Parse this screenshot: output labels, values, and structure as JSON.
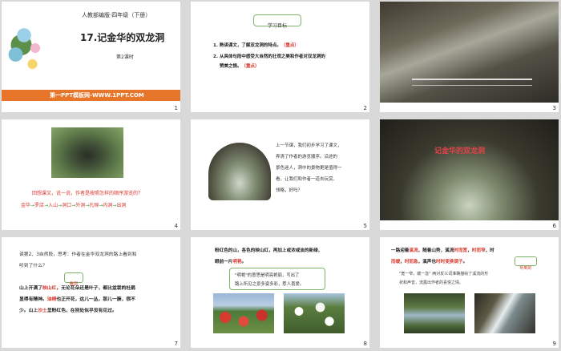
{
  "slides": [
    {
      "num": "1",
      "publisher": "人教部编版·四年级（下册）",
      "title": "17.记金华的双龙洞",
      "subtitle": "第2课时",
      "footer": "第一PPT模板网-WWW.1PPT.COM"
    },
    {
      "num": "2",
      "heading": "学习目标",
      "goal1": "1. 熟读课文，了解双龙洞的特点。",
      "goal1_tag": "（重点）",
      "goal2a": "2. 从具体句段中感受大自然的壮观之美和作者对双龙洞的",
      "goal2b": "赞美之情。",
      "goal2_tag": "（重点）"
    },
    {
      "num": "3"
    },
    {
      "num": "4",
      "question": "回想课文，说一说，作者是按照怎样的顺序游览的？",
      "route": [
        "金华",
        "罗店",
        "入山",
        "洞口",
        "外洞",
        "孔隙",
        "内洞",
        "出洞"
      ],
      "arrow": "→"
    },
    {
      "num": "5",
      "para": [
        "上一节课，我们初步学习了课文，",
        "弄清了作者的游览顺序。沿途的",
        "景色迷人，洞中的景物更是值得一",
        "看，让我们和作者一道去玩赏、",
        "领略，好吗？"
      ]
    },
    {
      "num": "6",
      "overlay_title": "记金华的双龙洞"
    },
    {
      "num": "7",
      "intro": [
        "读第2、3自然段，思考：作者在金华双龙洞的路上看到和",
        "听到了什么？"
      ],
      "tag": "看到",
      "body1_pre": "山上开满了",
      "body1_hl": "映山红",
      "body1_post": "，无论花朵还是叶子，都比盆栽的杜鹃",
      "body2": "显得有精神。",
      "body2_hl": "油桐",
      "body2_post": "也正开花，这儿一丛，那儿一簇，很不",
      "body3_pre": "少。山上",
      "body3_hl": "沙土",
      "body3_post": "呈粉红色，在别处似乎没有见过。"
    },
    {
      "num": "8",
      "line1": "粉红色的山，各色的映山红，再加上或浓或淡的新绿，",
      "line2_pre": "眼前一片",
      "line2_hl": "明艳",
      "line2_post": "。",
      "box1": "\"明艳\"的意思是明亮艳丽，写出了",
      "box2": "路上所见之景多姿多彩，惹人喜爱。"
    },
    {
      "num": "9",
      "line1_pre": "一路迎着",
      "line1_hl1": "溪流",
      "line1_mid": "，随着山势，溪流",
      "line1_hl2": "时而宽",
      "line1_sep": "，",
      "line1_hl3": "时而窄",
      "line1_end": "，时",
      "line2_hl1": "而缓",
      "line2_sep": "，",
      "line2_hl2": "时而急",
      "line2_post": "，溪声也",
      "line2_hl3": "时时变换调子",
      "line2_end": "。",
      "tag": "听到的",
      "note1": "\"宽一窄，缓一急\" 两对反义词准确描绘了溪流的形",
      "note2": "状和声音，流露出作者的喜悦之情。"
    }
  ]
}
